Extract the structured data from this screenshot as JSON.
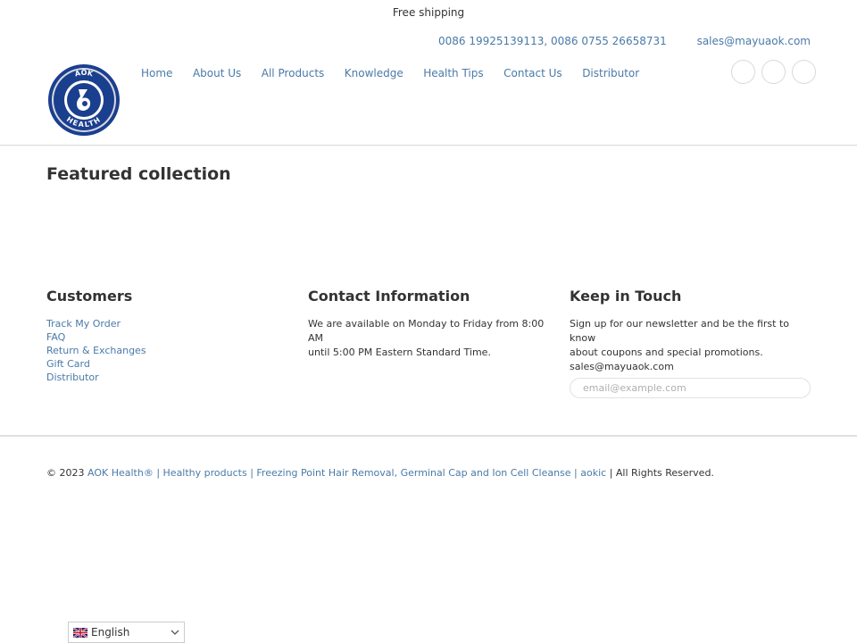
{
  "announcement": {
    "text": "Free shipping"
  },
  "contact": {
    "phones": "0086 19925139113, 0086 0755 26658731",
    "email": "sales@mayuaok.com"
  },
  "logo": {
    "top_text": "AOK",
    "bottom_text": "HEALTH"
  },
  "nav": {
    "items": [
      {
        "label": "Home"
      },
      {
        "label": "About Us"
      },
      {
        "label": "All Products"
      },
      {
        "label": "Knowledge"
      },
      {
        "label": "Health Tips"
      },
      {
        "label": "Contact Us"
      },
      {
        "label": "Distributor"
      }
    ]
  },
  "featured": {
    "title": "Featured collection"
  },
  "footer": {
    "customers": {
      "title": "Customers",
      "links": [
        "Track My Order",
        "FAQ",
        "Return & Exchanges",
        "Gift Card",
        "Distributor"
      ]
    },
    "contact_info": {
      "title": "Contact Information",
      "line1": "We are available on Monday to Friday from 8:00 AM",
      "line2": "until 5:00 PM Eastern Standard Time."
    },
    "keep_in_touch": {
      "title": "Keep in Touch",
      "line1": "Sign up for our newsletter and be the first to know",
      "line2": "about coupons and special promotions.",
      "email": "sales@mayuaok.com",
      "email_placeholder": "email@example.com"
    }
  },
  "copyright": {
    "prefix": "© 2023 ",
    "brand": "AOK Health®",
    "sep1": " | ",
    "tagline": "Healthy products | Freezing Point Hair Removal, Germinal Cap and Ion Cell Cleanse",
    "sep2": " | ",
    "link": "aokic",
    "suffix": " | All Rights Reserved."
  },
  "language": {
    "selected": "English"
  },
  "colors": {
    "link": "#4a7aa8",
    "text": "#333333",
    "logo_blue": "#1b3f8f"
  }
}
